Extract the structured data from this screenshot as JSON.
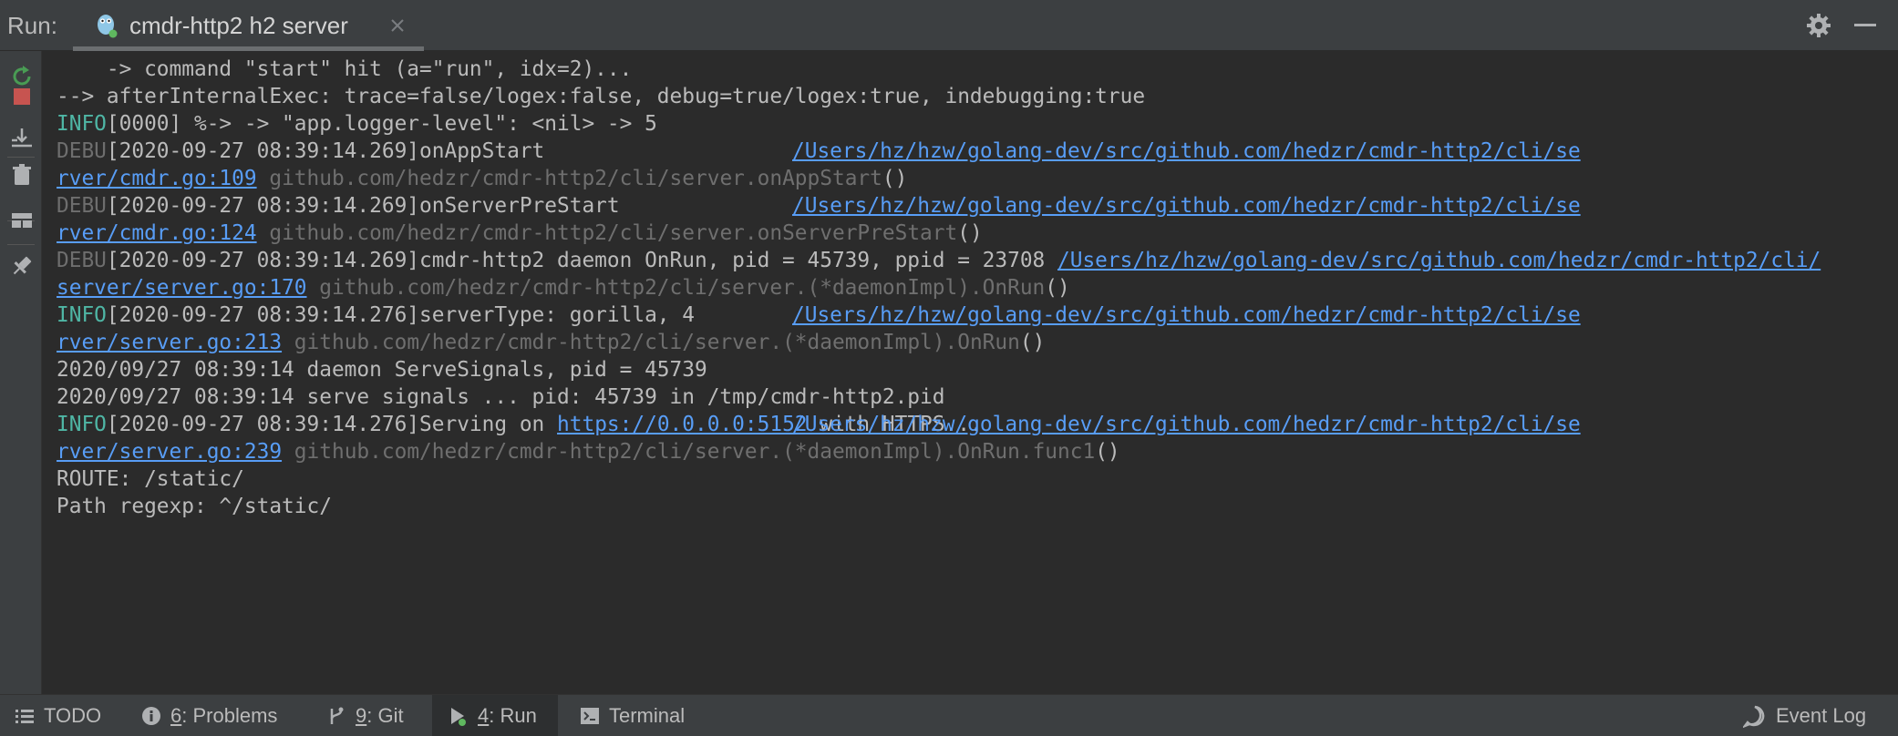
{
  "header": {
    "run_label": "Run:",
    "tab_title": "cmdr-http2 h2 server"
  },
  "toolbar_icons": [
    "rerun-icon",
    "stop-icon",
    "scroll-to-end-icon",
    "trash-icon",
    "layout-icon",
    "pin-icon"
  ],
  "console": {
    "l1": "    -> command \"start\" hit (a=\"run\", idx=2)...",
    "l2": "--> afterInternalExec: trace=false/logex:false, debug=true/logex:true, indebugging:true",
    "l3_lvl": "INFO",
    "l3_msg": "[0000] %-> -> \"app.logger-level\": <nil> -> 5",
    "l4_lvl": "DEBU",
    "l4_msg": "[2020-09-27 08:39:14.269]onAppStart",
    "l4_path": "/Users/hz/hzw/golang-dev/src/github.com/hedzr/cmdr-http2/cli/se",
    "l5_link": "rver/cmdr.go:109",
    "l5_func": "github.com/hedzr/cmdr-http2/cli/server.onAppStart",
    "l5_paren": "()",
    "l6_lvl": "DEBU",
    "l6_msg": "[2020-09-27 08:39:14.269]onServerPreStart",
    "l6_path": "/Users/hz/hzw/golang-dev/src/github.com/hedzr/cmdr-http2/cli/se",
    "l7_link": "rver/cmdr.go:124",
    "l7_func": "github.com/hedzr/cmdr-http2/cli/server.onServerPreStart",
    "l7_paren": "()",
    "l8_lvl": "DEBU",
    "l8_msg": "[2020-09-27 08:39:14.269]cmdr-http2 daemon OnRun, pid = 45739, ppid = 23708 ",
    "l8_path": "/Users/hz/hzw/golang-dev/src/github.com/hedzr/cmdr-http2/cli/",
    "l9_link": "server/server.go:170",
    "l9_func": "github.com/hedzr/cmdr-http2/cli/server.(*daemonImpl).OnRun",
    "l9_paren": "()",
    "l10_lvl": "INFO",
    "l10_msg": "[2020-09-27 08:39:14.276]serverType: gorilla, 4",
    "l10_path": "/Users/hz/hzw/golang-dev/src/github.com/hedzr/cmdr-http2/cli/se",
    "l11_link": "rver/server.go:213",
    "l11_func": "github.com/hedzr/cmdr-http2/cli/server.(*daemonImpl).OnRun",
    "l11_paren": "()",
    "l12": "2020/09/27 08:39:14 daemon ServeSignals, pid = 45739",
    "l13": "2020/09/27 08:39:14 serve signals ... pid: 45739 in /tmp/cmdr-http2.pid",
    "l14_lvl": "INFO",
    "l14_msg": "[2020-09-27 08:39:14.276]Serving on ",
    "l14_url": "https://0.0.0.0:5152",
    "l14_rest": " with HTTPS...",
    "l14_path": "/Users/hz/hzw/golang-dev/src/github.com/hedzr/cmdr-http2/cli/se",
    "l15_link": "rver/server.go:239",
    "l15_func": "github.com/hedzr/cmdr-http2/cli/server.(*daemonImpl).OnRun.func1",
    "l15_paren": "()",
    "l16": "ROUTE: /static/",
    "l17": "Path regexp: ^/static/"
  },
  "bottom_bar": {
    "todo": "TODO",
    "problems_num": "6",
    "problems_label": ": Problems",
    "git_num": "9",
    "git_label": ": Git",
    "run_num": "4",
    "run_label": ": Run",
    "terminal": "Terminal",
    "event_log": "Event Log"
  },
  "colors": {
    "info": "#4fb6a5",
    "debu": "#6e6e6e",
    "link": "#589df6",
    "stop": "#c75450",
    "rerun": "#499c54"
  }
}
